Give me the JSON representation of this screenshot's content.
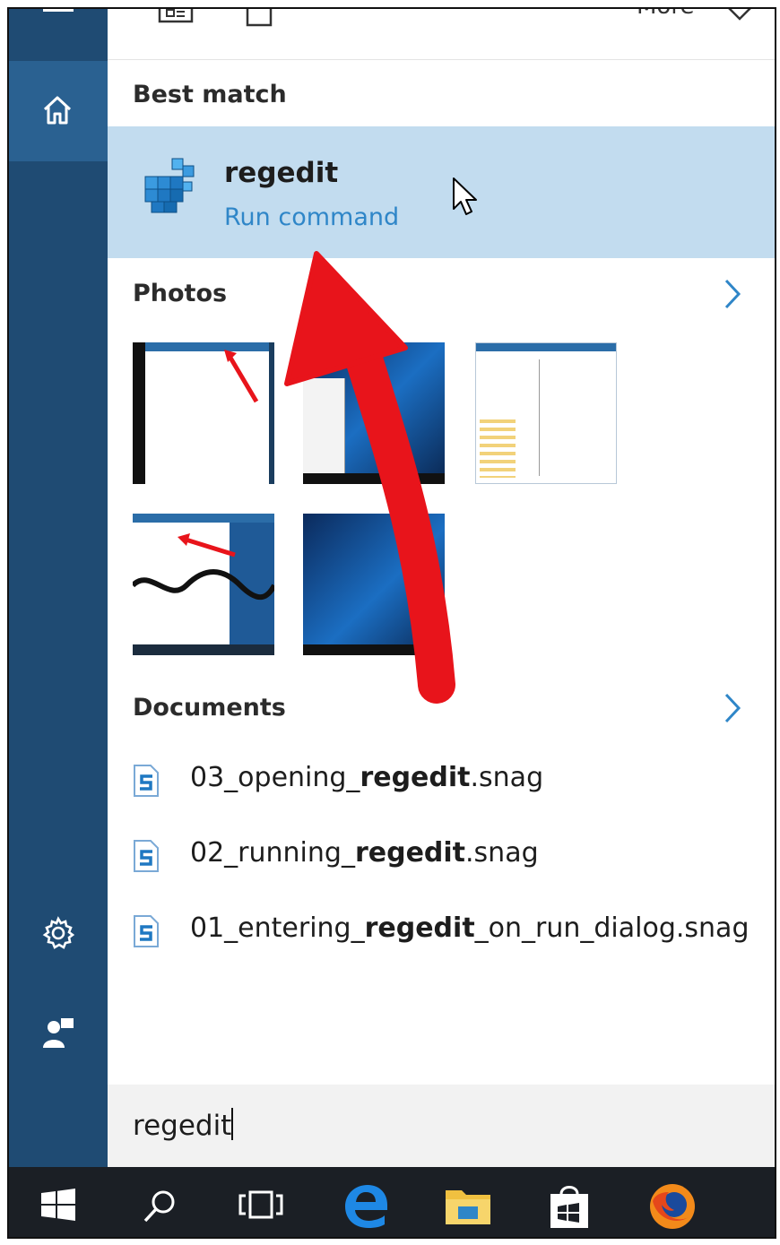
{
  "top_strip": {
    "more_label": "More"
  },
  "sections": {
    "best_match": "Best match",
    "photos": "Photos",
    "documents": "Documents"
  },
  "best_match": {
    "name": "regedit",
    "type": "Run command"
  },
  "documents": [
    {
      "prefix": "03_opening_",
      "bold": "regedit",
      "suffix": ".snag"
    },
    {
      "prefix": "02_running_",
      "bold": "regedit",
      "suffix": ".snag"
    },
    {
      "prefix": "01_entering_",
      "bold": "regedit",
      "suffix": "_on_run_dialog.snag"
    }
  ],
  "search": {
    "query": "regedit"
  },
  "colors": {
    "rail": "#1f4b73",
    "rail_active": "#2a6191",
    "highlight": "#c2dcef",
    "link": "#2f86c8",
    "annotation_arrow": "#e8141b",
    "taskbar": "#1b1f25"
  },
  "icons": {
    "rail": [
      "hamburger-icon",
      "home-icon",
      "settings-gear-icon",
      "user-feedback-icon"
    ],
    "taskbar": [
      "windows-start-icon",
      "search-icon",
      "task-view-icon",
      "edge-browser-icon",
      "file-explorer-icon",
      "store-icon",
      "firefox-icon"
    ]
  }
}
